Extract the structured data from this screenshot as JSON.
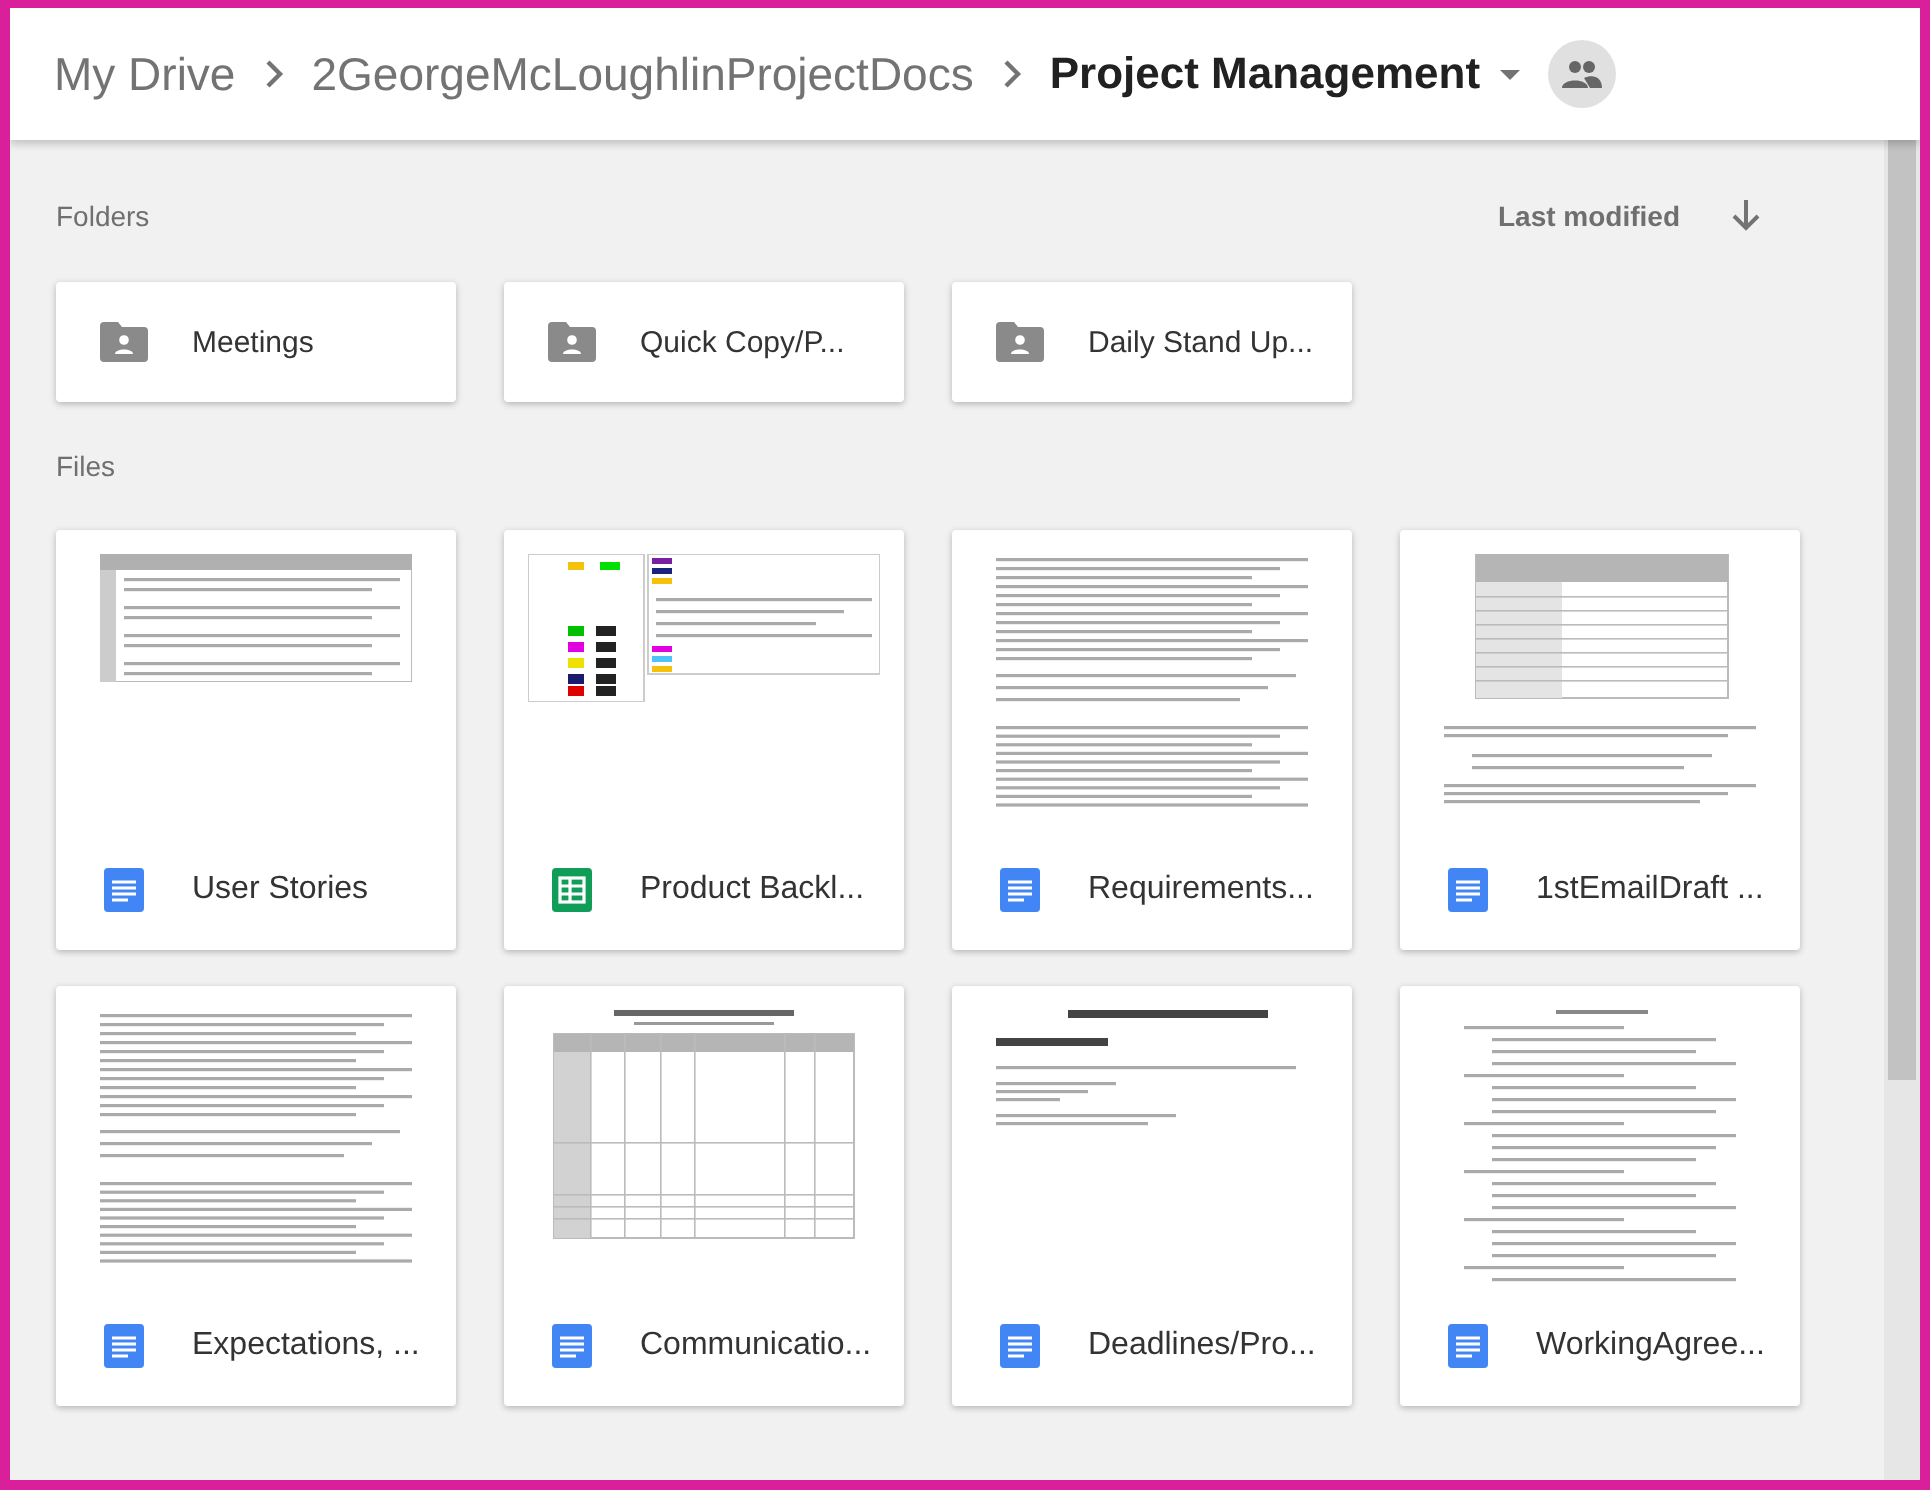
{
  "breadcrumb": {
    "items": [
      "My Drive",
      "2GeorgeMcLoughlinProjectDocs"
    ],
    "current": "Project Management"
  },
  "folders_section": {
    "label": "Folders",
    "sort": "Last modified"
  },
  "folders": [
    {
      "name": "Meetings"
    },
    {
      "name": "Quick Copy/P..."
    },
    {
      "name": "Daily Stand Up..."
    }
  ],
  "files_section": {
    "label": "Files"
  },
  "files": [
    {
      "name": "User Stories",
      "kind": "doc-table"
    },
    {
      "name": "Product Backl...",
      "kind": "sheet"
    },
    {
      "name": "Requirements...",
      "kind": "doc-text"
    },
    {
      "name": "1stEmailDraft ...",
      "kind": "doc-tabletext"
    },
    {
      "name": "Expectations, ...",
      "kind": "doc-text"
    },
    {
      "name": "Communicatio...",
      "kind": "doc-widetable"
    },
    {
      "name": "Deadlines/Pro...",
      "kind": "doc-heading"
    },
    {
      "name": "WorkingAgree...",
      "kind": "doc-list"
    }
  ]
}
